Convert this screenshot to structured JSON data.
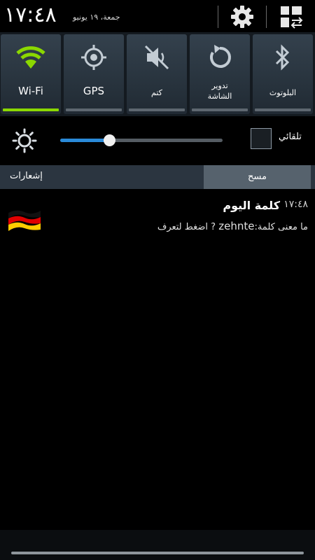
{
  "header": {
    "clock": "١٧:٤٨",
    "date": "جمعة، ١٩ يونيو"
  },
  "quick_settings": [
    {
      "id": "wifi",
      "label": "Wi-Fi",
      "icon": "wifi-icon",
      "active": true
    },
    {
      "id": "gps",
      "label": "GPS",
      "icon": "gps-icon",
      "active": false
    },
    {
      "id": "mute",
      "label": "كتم",
      "icon": "mute-icon",
      "active": false
    },
    {
      "id": "rotate",
      "label": "تدوير الشاشة",
      "icon": "rotate-icon",
      "active": false
    },
    {
      "id": "bluetooth",
      "label": "البلوتوث",
      "icon": "bluetooth-icon",
      "active": false
    }
  ],
  "brightness": {
    "auto_label": "تلقائي",
    "auto_checked": false,
    "level": 0.3
  },
  "tabs": {
    "notifications_label": "إشعارات",
    "clear_label": "مسح"
  },
  "notification": {
    "title": "كلمة اليوم",
    "time": "١٧:٤٨",
    "body_prefix": "ما معنى كلمة:",
    "body_word": "zehnte",
    "body_suffix": " ? اضغط لتعرف",
    "icon": "germany-flag-icon"
  },
  "colors": {
    "accent_green": "#8bd800",
    "slider_blue": "#2a8ad8",
    "tile_bg": "#2c3843"
  }
}
